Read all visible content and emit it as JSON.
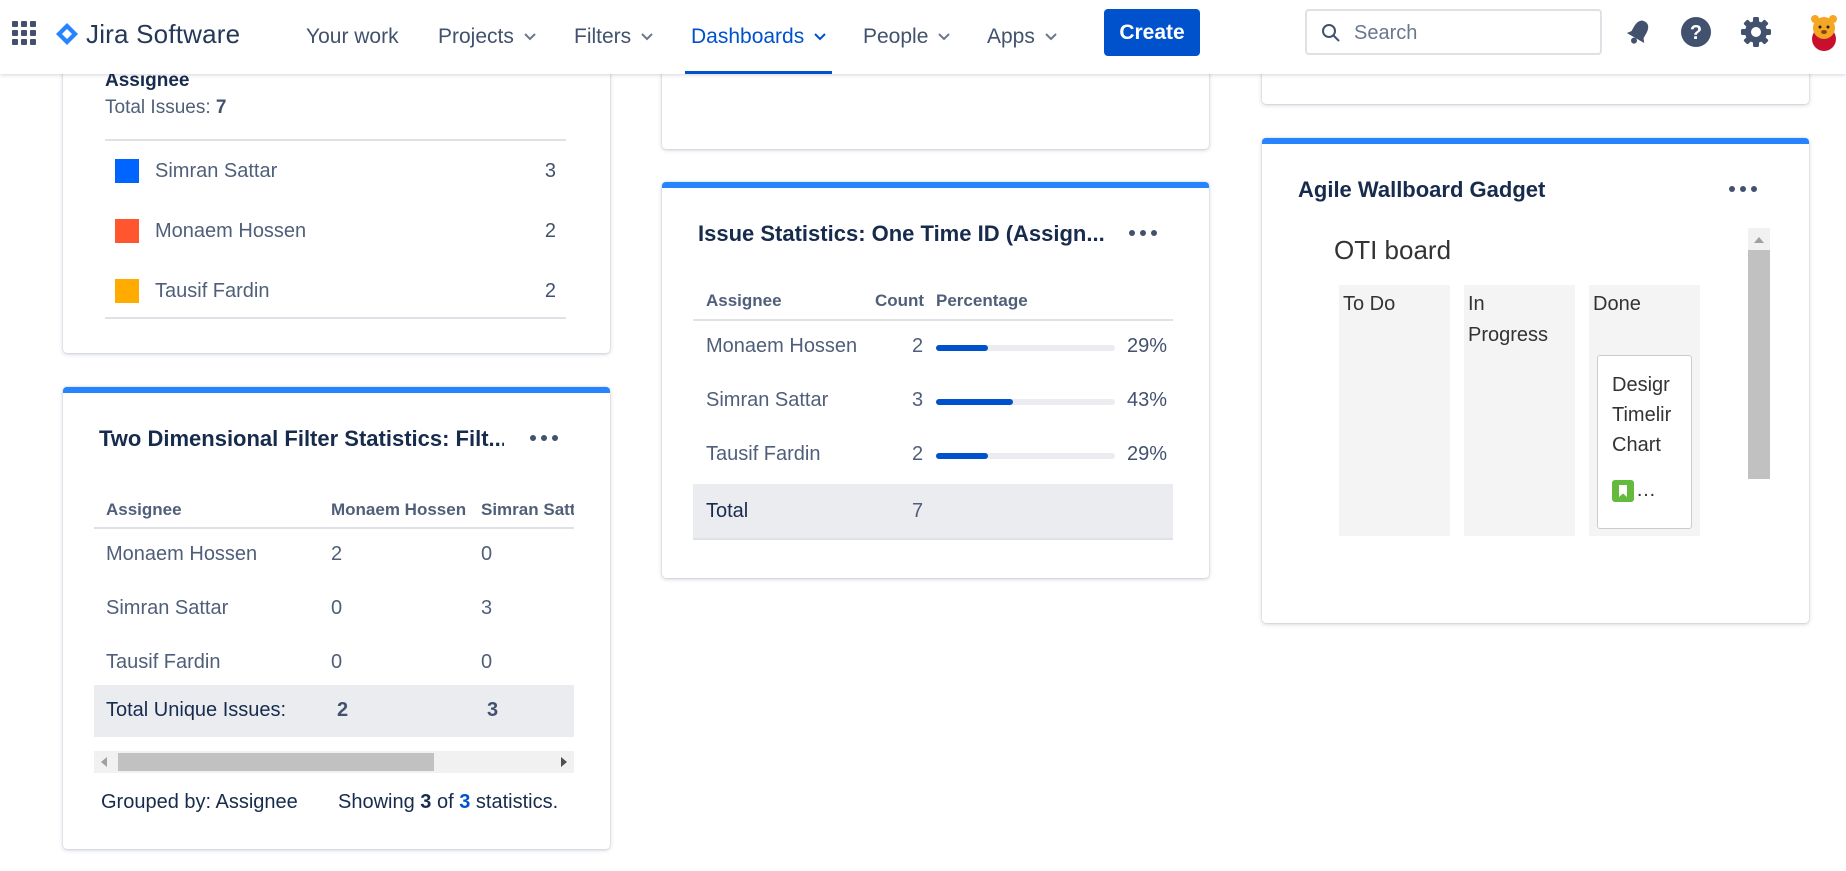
{
  "nav": {
    "product": "Jira Software",
    "items": [
      {
        "label": "Your work",
        "dropdown": false
      },
      {
        "label": "Projects",
        "dropdown": true
      },
      {
        "label": "Filters",
        "dropdown": true
      },
      {
        "label": "Dashboards",
        "dropdown": true,
        "active": true
      },
      {
        "label": "People",
        "dropdown": true
      },
      {
        "label": "Apps",
        "dropdown": true
      }
    ],
    "create_label": "Create",
    "search_placeholder": "Search",
    "icons": [
      "apps-grid-icon",
      "jira-logo-icon",
      "notifications-icon",
      "help-icon",
      "settings-icon",
      "avatar"
    ]
  },
  "pie_legend_card": {
    "heading": "Assignee",
    "total_label": "Total Issues:",
    "total_value": "7",
    "rows": [
      {
        "name": "Simran Sattar",
        "count": "3",
        "color": "#0065ff"
      },
      {
        "name": "Monaem Hossen",
        "count": "2",
        "color": "#ff5630"
      },
      {
        "name": "Tausif Fardin",
        "count": "2",
        "color": "#ffab00"
      }
    ]
  },
  "two_dim_card": {
    "title": "Two Dimensional Filter Statistics: Filt...",
    "headers": [
      "Assignee",
      "Monaem Hossen",
      "Simran Satt"
    ],
    "rows": [
      {
        "name": "Monaem Hossen",
        "c1": "2",
        "c2": "0"
      },
      {
        "name": "Simran Sattar",
        "c1": "0",
        "c2": "3"
      },
      {
        "name": "Tausif Fardin",
        "c1": "0",
        "c2": "0"
      }
    ],
    "total_label": "Total Unique Issues:",
    "total_c1": "2",
    "total_c2": "3",
    "grouped_by": "Grouped by: Assignee",
    "showing_prefix": "Showing",
    "showing_count": "3",
    "showing_of": "of",
    "showing_total": "3",
    "showing_suffix": "statistics."
  },
  "issue_stats_card": {
    "title": "Issue Statistics: One Time ID (Assign...",
    "headers": [
      "Assignee",
      "Count",
      "Percentage"
    ],
    "rows": [
      {
        "name": "Monaem Hossen",
        "count": "2",
        "percent_label": "29%",
        "fraction": 0.29
      },
      {
        "name": "Simran Sattar",
        "count": "3",
        "percent_label": "43%",
        "fraction": 0.43
      },
      {
        "name": "Tausif Fardin",
        "count": "2",
        "percent_label": "29%",
        "fraction": 0.29
      }
    ],
    "total_label": "Total",
    "total_count": "7"
  },
  "wallboard_card": {
    "title": "Agile Wallboard Gadget",
    "board_name": "OTI board",
    "columns": [
      "To Do",
      "In\nProgress",
      "Done"
    ],
    "issue_lines": [
      "Desigr",
      "Timelir",
      "Chart"
    ],
    "issue_ellipsis": "…",
    "issue_type_color": "#63ba3c"
  }
}
